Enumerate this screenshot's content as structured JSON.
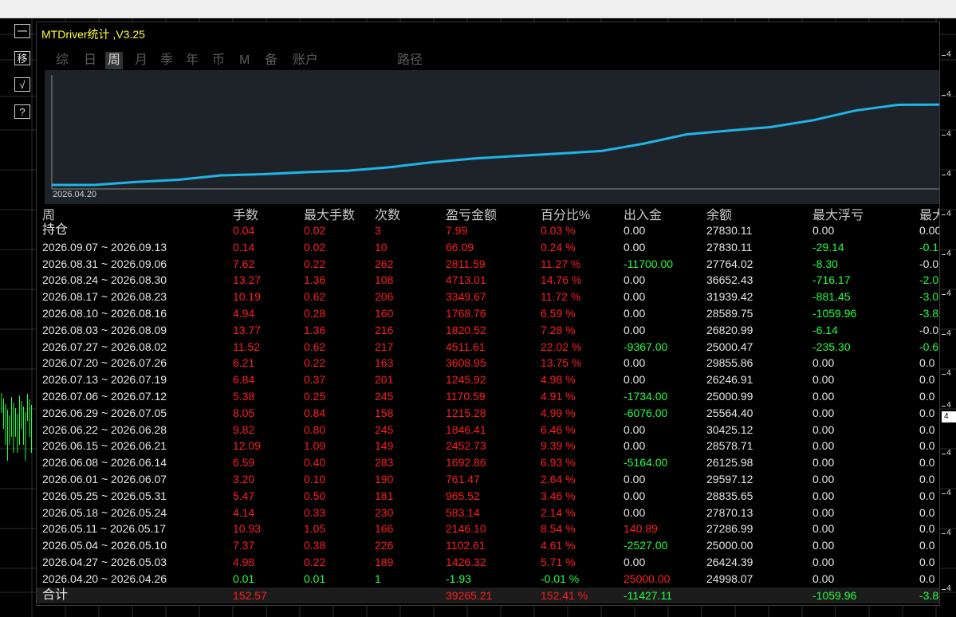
{
  "panel": {
    "title": "MTDriver统计 ,V3.25",
    "tabs": [
      {
        "label": "综",
        "active": false
      },
      {
        "label": "日",
        "active": false
      },
      {
        "label": "周",
        "active": true
      },
      {
        "label": "月",
        "active": false
      },
      {
        "label": "季",
        "active": false
      },
      {
        "label": "年",
        "active": false
      },
      {
        "label": "币",
        "active": false
      },
      {
        "label": "M",
        "active": false
      },
      {
        "label": "备",
        "active": false
      },
      {
        "label": "账户",
        "active": false
      },
      {
        "label": "路径",
        "active": false
      }
    ],
    "equity_start_date": "2026.04.20"
  },
  "side_buttons": [
    "一",
    "移",
    "√",
    "?"
  ],
  "price_scale_digits": [
    "4",
    "4",
    "4",
    "4",
    "4",
    "4",
    "4",
    "4",
    "4",
    "4",
    "4",
    "4",
    "4",
    "4"
  ],
  "price_marker": "4",
  "table": {
    "headers": [
      "周",
      "手数",
      "最大手数",
      "次数",
      "盈亏金额",
      "百分比%",
      "出入金",
      "余额",
      "最大浮亏",
      "最大"
    ],
    "holding": {
      "label": "持仓",
      "lots": "0.04",
      "max_lots": "0.02",
      "count": "3",
      "pnl": "7.99",
      "pct": "0.03 %",
      "flow": "0.00",
      "balance": "27830.11",
      "max_dd": "0.00",
      "last": "0.00"
    },
    "rows": [
      {
        "week": "2026.09.07 ~ 2026.09.13",
        "lots": "0.14",
        "max_lots": "0.02",
        "count": "10",
        "pnl": "66.09",
        "pct": "0.24 %",
        "flow": "0.00",
        "balance": "27830.11",
        "max_dd": "-29.14",
        "last": "-0.1"
      },
      {
        "week": "2026.08.31 ~ 2026.09.06",
        "lots": "7.62",
        "max_lots": "0.22",
        "count": "262",
        "pnl": "2811.59",
        "pct": "11.27 %",
        "flow": "-11700.00",
        "balance": "27764.02",
        "max_dd": "-8.30",
        "last": "-0.0"
      },
      {
        "week": "2026.08.24 ~ 2026.08.30",
        "lots": "13.27",
        "max_lots": "1.36",
        "count": "108",
        "pnl": "4713.01",
        "pct": "14.76 %",
        "flow": "0.00",
        "balance": "36652.43",
        "max_dd": "-716.17",
        "last": "-2.0"
      },
      {
        "week": "2026.08.17 ~ 2026.08.23",
        "lots": "10.19",
        "max_lots": "0.62",
        "count": "206",
        "pnl": "3349.67",
        "pct": "11.72 %",
        "flow": "0.00",
        "balance": "31939.42",
        "max_dd": "-881.45",
        "last": "-3.0"
      },
      {
        "week": "2026.08.10 ~ 2026.08.16",
        "lots": "4.94",
        "max_lots": "0.28",
        "count": "160",
        "pnl": "1768.76",
        "pct": "6.59 %",
        "flow": "0.00",
        "balance": "28589.75",
        "max_dd": "-1059.96",
        "last": "-3.8"
      },
      {
        "week": "2026.08.03 ~ 2026.08.09",
        "lots": "13.77",
        "max_lots": "1.36",
        "count": "216",
        "pnl": "1820.52",
        "pct": "7.28 %",
        "flow": "0.00",
        "balance": "26820.99",
        "max_dd": "-6.14",
        "last": "-0.0"
      },
      {
        "week": "2026.07.27 ~ 2026.08.02",
        "lots": "11.52",
        "max_lots": "0.62",
        "count": "217",
        "pnl": "4511.61",
        "pct": "22.02 %",
        "flow": "-9367.00",
        "balance": "25000.47",
        "max_dd": "-235.30",
        "last": "-0.6"
      },
      {
        "week": "2026.07.20 ~ 2026.07.26",
        "lots": "6.21",
        "max_lots": "0.22",
        "count": "163",
        "pnl": "3608.95",
        "pct": "13.75 %",
        "flow": "0.00",
        "balance": "29855.86",
        "max_dd": "0.00",
        "last": "0.0"
      },
      {
        "week": "2026.07.13 ~ 2026.07.19",
        "lots": "6.84",
        "max_lots": "0.37",
        "count": "201",
        "pnl": "1245.92",
        "pct": "4.98 %",
        "flow": "0.00",
        "balance": "26246.91",
        "max_dd": "0.00",
        "last": "0.0"
      },
      {
        "week": "2026.07.06 ~ 2026.07.12",
        "lots": "5.38",
        "max_lots": "0.25",
        "count": "245",
        "pnl": "1170.59",
        "pct": "4.91 %",
        "flow": "-1734.00",
        "balance": "25000.99",
        "max_dd": "0.00",
        "last": "0.0"
      },
      {
        "week": "2026.06.29 ~ 2026.07.05",
        "lots": "8.05",
        "max_lots": "0.84",
        "count": "158",
        "pnl": "1215.28",
        "pct": "4.99 %",
        "flow": "-6076.00",
        "balance": "25564.40",
        "max_dd": "0.00",
        "last": "0.0"
      },
      {
        "week": "2026.06.22 ~ 2026.06.28",
        "lots": "9.82",
        "max_lots": "0.80",
        "count": "245",
        "pnl": "1846.41",
        "pct": "6.46 %",
        "flow": "0.00",
        "balance": "30425.12",
        "max_dd": "0.00",
        "last": "0.0"
      },
      {
        "week": "2026.06.15 ~ 2026.06.21",
        "lots": "12.09",
        "max_lots": "1.09",
        "count": "149",
        "pnl": "2452.73",
        "pct": "9.39 %",
        "flow": "0.00",
        "balance": "28578.71",
        "max_dd": "0.00",
        "last": "0.0"
      },
      {
        "week": "2026.06.08 ~ 2026.06.14",
        "lots": "6.59",
        "max_lots": "0.40",
        "count": "283",
        "pnl": "1692.86",
        "pct": "6.93 %",
        "flow": "-5164.00",
        "balance": "26125.98",
        "max_dd": "0.00",
        "last": "0.0"
      },
      {
        "week": "2026.06.01 ~ 2026.06.07",
        "lots": "3.20",
        "max_lots": "0.10",
        "count": "190",
        "pnl": "761.47",
        "pct": "2.64 %",
        "flow": "0.00",
        "balance": "29597.12",
        "max_dd": "0.00",
        "last": "0.0"
      },
      {
        "week": "2026.05.25 ~ 2026.05.31",
        "lots": "5.47",
        "max_lots": "0.50",
        "count": "181",
        "pnl": "965.52",
        "pct": "3.46 %",
        "flow": "0.00",
        "balance": "28835.65",
        "max_dd": "0.00",
        "last": "0.0"
      },
      {
        "week": "2026.05.18 ~ 2026.05.24",
        "lots": "4.14",
        "max_lots": "0.33",
        "count": "230",
        "pnl": "583.14",
        "pct": "2.14 %",
        "flow": "0.00",
        "balance": "27870.13",
        "max_dd": "0.00",
        "last": "0.0"
      },
      {
        "week": "2026.05.11 ~ 2026.05.17",
        "lots": "10.93",
        "max_lots": "1.05",
        "count": "166",
        "pnl": "2146.10",
        "pct": "8.54 %",
        "flow": "140.89",
        "balance": "27286.99",
        "max_dd": "0.00",
        "last": "0.0"
      },
      {
        "week": "2026.05.04 ~ 2026.05.10",
        "lots": "7.37",
        "max_lots": "0.38",
        "count": "226",
        "pnl": "1102.61",
        "pct": "4.61 %",
        "flow": "-2527.00",
        "balance": "25000.00",
        "max_dd": "0.00",
        "last": "0.0"
      },
      {
        "week": "2026.04.27 ~ 2026.05.03",
        "lots": "4.98",
        "max_lots": "0.22",
        "count": "189",
        "pnl": "1426.32",
        "pct": "5.71 %",
        "flow": "0.00",
        "balance": "26424.39",
        "max_dd": "0.00",
        "last": "0.0"
      },
      {
        "week": "2026.04.20 ~ 2026.04.26",
        "lots": "0.01",
        "max_lots": "0.01",
        "count": "1",
        "pnl": "-1.93",
        "pct": "-0.01 %",
        "flow": "25000.00",
        "balance": "24998.07",
        "max_dd": "0.00",
        "last": "0.0"
      }
    ],
    "total": {
      "label": "合计",
      "lots": "152.57",
      "max_lots": "",
      "count": "",
      "pnl": "39265.21",
      "pct": "152.41 %",
      "flow": "-11427.11",
      "balance": "",
      "max_dd": "-1059.96",
      "last": "-3.8"
    }
  },
  "colors": {
    "profit": "#ff1e1e",
    "loss": "#22ff44",
    "neutral": "#e6e6e6",
    "equity_line": "#1fb4ea",
    "title": "#ffff33"
  }
}
